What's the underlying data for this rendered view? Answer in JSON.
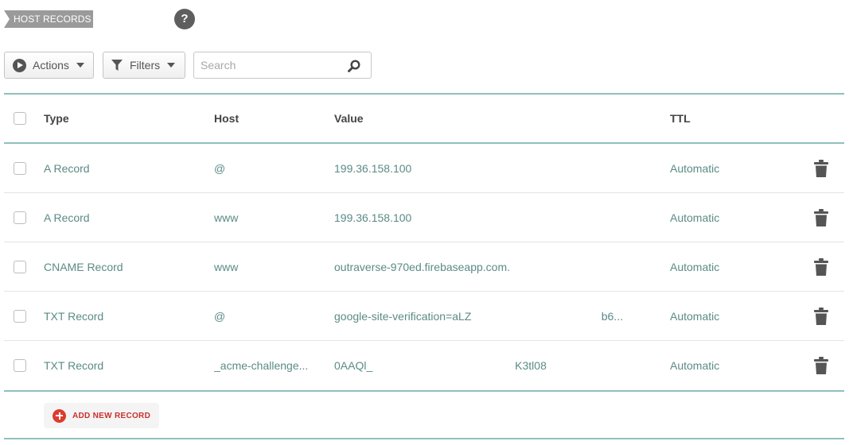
{
  "section": {
    "title": "HOST RECORDS",
    "help_icon": "question-mark-icon",
    "help_glyph": "?"
  },
  "toolbar": {
    "actions_label": "Actions",
    "filters_label": "Filters",
    "search_placeholder": "Search",
    "search_value": ""
  },
  "table": {
    "columns": {
      "type": "Type",
      "host": "Host",
      "value": "Value",
      "ttl": "TTL"
    },
    "rows": [
      {
        "type": "A Record",
        "host": "@",
        "value": "199.36.158.100",
        "ttl": "Automatic"
      },
      {
        "type": "A Record",
        "host": "www",
        "value": "199.36.158.100",
        "ttl": "Automatic"
      },
      {
        "type": "CNAME Record",
        "host": "www",
        "value": "outraverse-970ed.firebaseapp.com.",
        "ttl": "Automatic"
      },
      {
        "type": "TXT Record",
        "host": "@",
        "value": "google-site-verification=aLZ                                          b6...",
        "ttl": "Automatic"
      },
      {
        "type": "TXT Record",
        "host": "_acme-challenge...",
        "value": "0AAQl_                                              K3tl08",
        "ttl": "Automatic"
      }
    ]
  },
  "footer": {
    "add_label": "ADD NEW RECORD"
  },
  "colors": {
    "accent_teal": "#8fc0bd",
    "link_teal": "#5b8b86",
    "danger_red": "#dd3b2e"
  }
}
